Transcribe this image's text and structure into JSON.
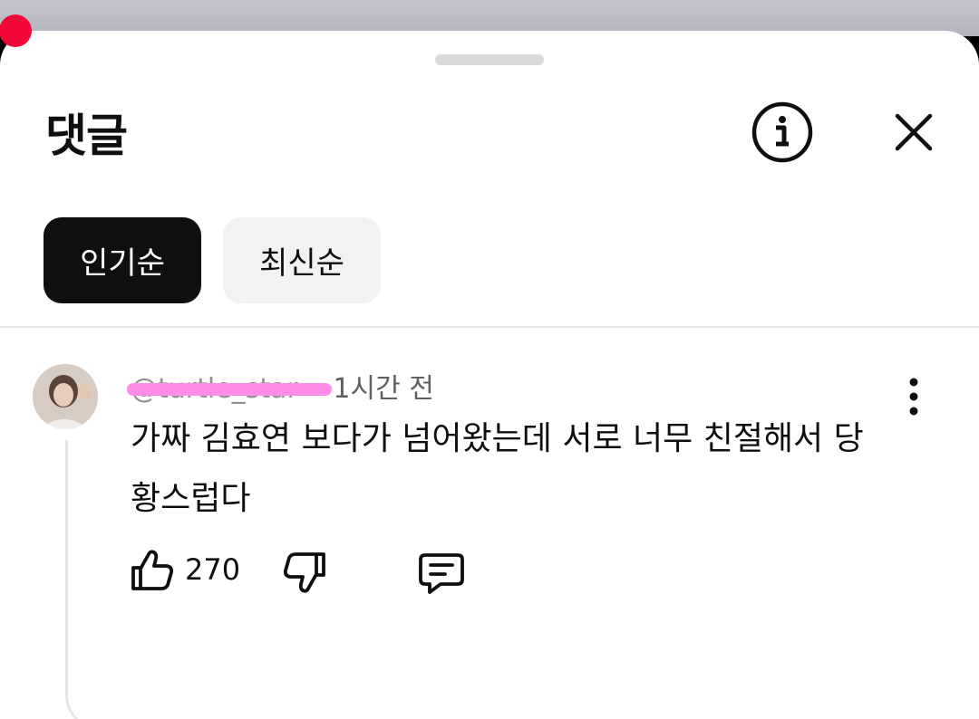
{
  "colors": {
    "accent_dark": "#0f0f0f",
    "chip_inactive_bg": "#f2f2f2",
    "recording_dot": "#f2093a",
    "redaction_marker": "#ff8ce6"
  },
  "header": {
    "title": "댓글",
    "info_icon": "info-circle-icon",
    "close_icon": "close-icon"
  },
  "sort_chips": [
    {
      "label": "인기순",
      "selected": true
    },
    {
      "label": "최신순",
      "selected": false
    }
  ],
  "comment": {
    "author": "@turtle_star",
    "separator": "·",
    "time": "1시간 전",
    "text": "가짜 김효연 보다가 넘어왔는데 서로 너무 친절해서 당황스럽다",
    "like_count": "270",
    "icons": {
      "like": "thumbs-up-icon",
      "dislike": "thumbs-down-icon",
      "reply": "reply-comment-icon",
      "more": "more-vertical-icon"
    }
  }
}
